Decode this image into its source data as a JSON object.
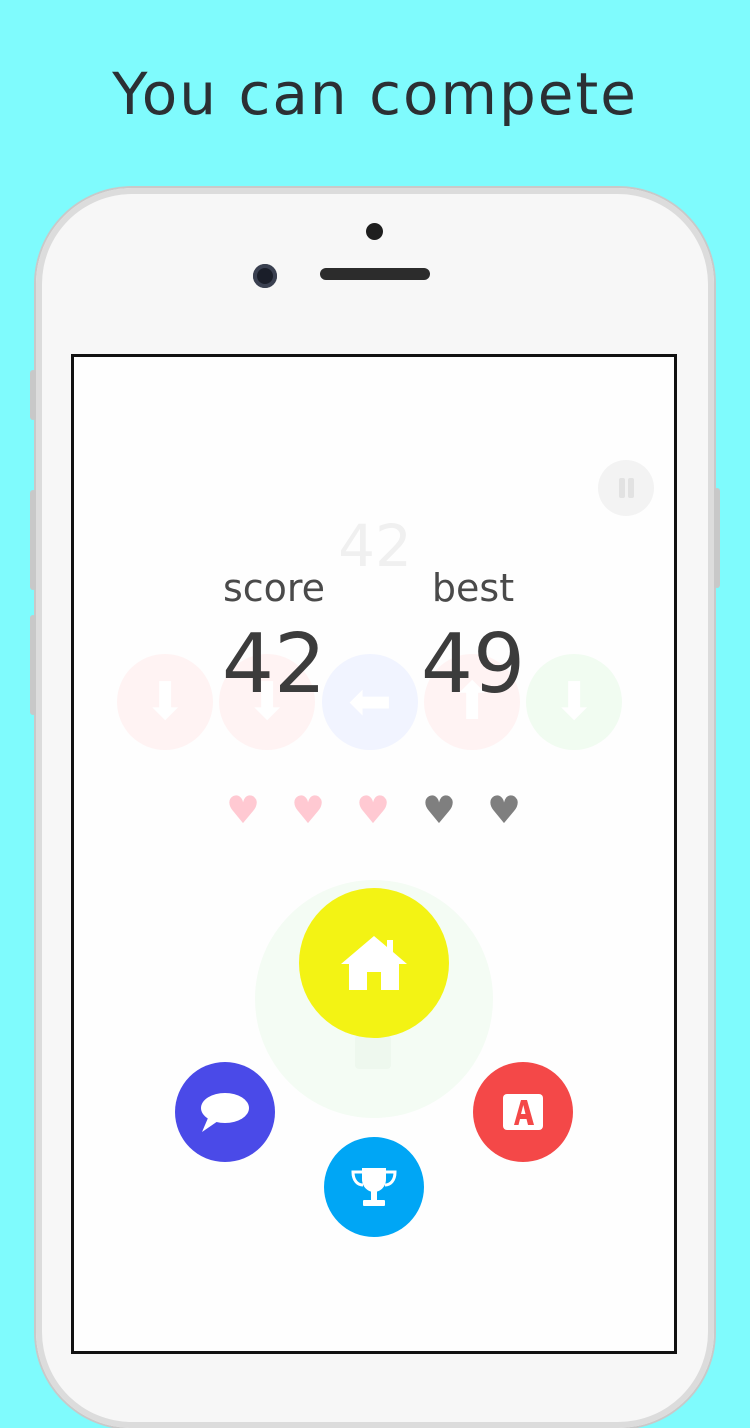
{
  "headline": "You can compete",
  "game": {
    "ghost_score": "42",
    "score_label": "score",
    "score_value": "42",
    "best_label": "best",
    "best_value": "49"
  },
  "hearts": [
    {
      "state": "full",
      "color": "#ffc9d2"
    },
    {
      "state": "full",
      "color": "#ffc9d2"
    },
    {
      "state": "full",
      "color": "#ffc9d2"
    },
    {
      "state": "empty",
      "color": "#7f7f7f"
    },
    {
      "state": "empty",
      "color": "#7f7f7f"
    }
  ],
  "lives_remaining": 3,
  "lives_total": 5,
  "buttons": {
    "home": {
      "icon": "home-icon",
      "color": "#f3f314"
    },
    "chat": {
      "icon": "speech-bubble-icon",
      "color": "#4a4ae8"
    },
    "ranking": {
      "icon": "trophy-icon",
      "color": "#00a6f5"
    },
    "app": {
      "icon": "app-icon",
      "color": "#f44848"
    }
  },
  "colors": {
    "background": "#7ffbfd",
    "text": "#3c3c3c"
  }
}
